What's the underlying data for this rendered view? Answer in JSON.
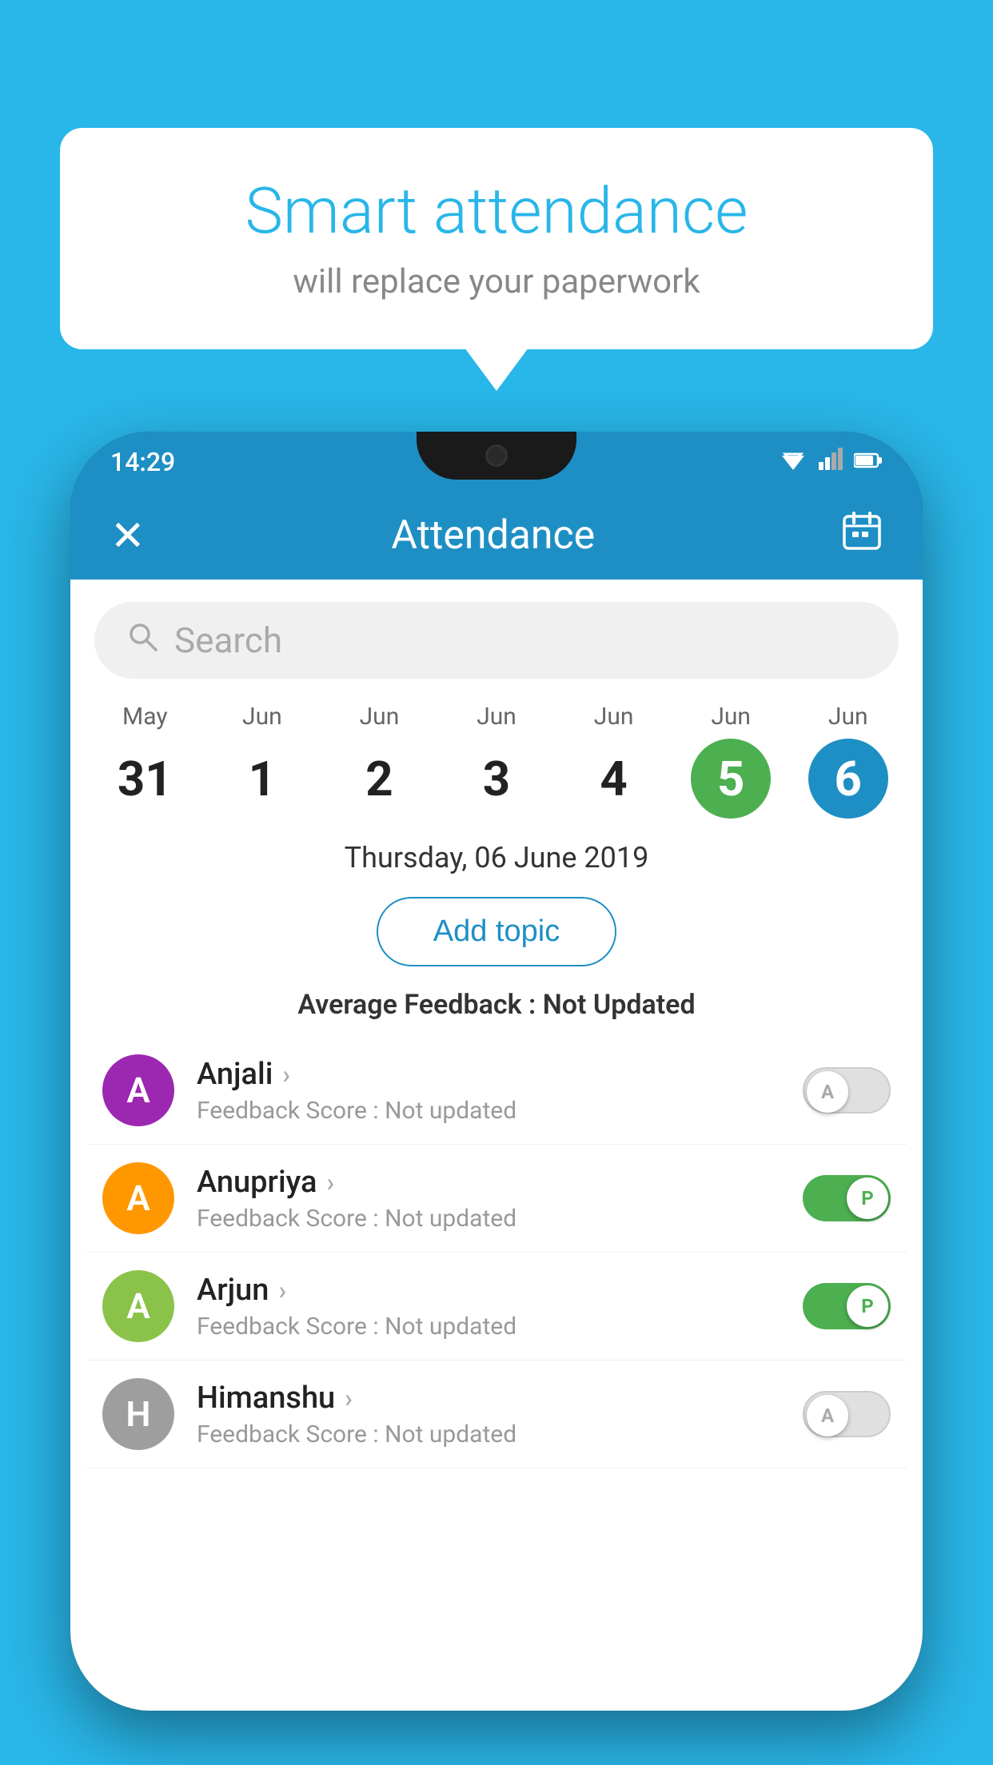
{
  "page": {
    "background_color": "#29b6e8"
  },
  "speech_bubble": {
    "title": "Smart attendance",
    "subtitle": "will replace your paperwork"
  },
  "status_bar": {
    "time": "14:29",
    "wifi_icon": "▼",
    "signal_icon": "▲",
    "battery_icon": "▮"
  },
  "app_header": {
    "close_label": "✕",
    "title": "Attendance",
    "calendar_icon": "📅"
  },
  "search": {
    "placeholder": "Search"
  },
  "date_carousel": {
    "items": [
      {
        "month": "May",
        "day": "31",
        "state": "normal"
      },
      {
        "month": "Jun",
        "day": "1",
        "state": "normal"
      },
      {
        "month": "Jun",
        "day": "2",
        "state": "normal"
      },
      {
        "month": "Jun",
        "day": "3",
        "state": "normal"
      },
      {
        "month": "Jun",
        "day": "4",
        "state": "normal"
      },
      {
        "month": "Jun",
        "day": "5",
        "state": "today"
      },
      {
        "month": "Jun",
        "day": "6",
        "state": "selected"
      }
    ]
  },
  "selected_date": {
    "text": "Thursday, 06 June 2019"
  },
  "add_topic_button": {
    "label": "Add topic"
  },
  "average_feedback": {
    "label": "Average Feedback : ",
    "value": "Not Updated"
  },
  "students": [
    {
      "name": "Anjali",
      "avatar_letter": "A",
      "avatar_color": "#9c27b0",
      "feedback_label": "Feedback Score : ",
      "feedback_value": "Not updated",
      "attendance": "absent",
      "toggle_letter": "A"
    },
    {
      "name": "Anupriya",
      "avatar_letter": "A",
      "avatar_color": "#ff9800",
      "feedback_label": "Feedback Score : ",
      "feedback_value": "Not updated",
      "attendance": "present",
      "toggle_letter": "P"
    },
    {
      "name": "Arjun",
      "avatar_letter": "A",
      "avatar_color": "#8bc34a",
      "feedback_label": "Feedback Score : ",
      "feedback_value": "Not updated",
      "attendance": "present",
      "toggle_letter": "P"
    },
    {
      "name": "Himanshu",
      "avatar_letter": "H",
      "avatar_color": "#9e9e9e",
      "feedback_label": "Feedback Score : ",
      "feedback_value": "Not updated",
      "attendance": "absent",
      "toggle_letter": "A"
    }
  ]
}
